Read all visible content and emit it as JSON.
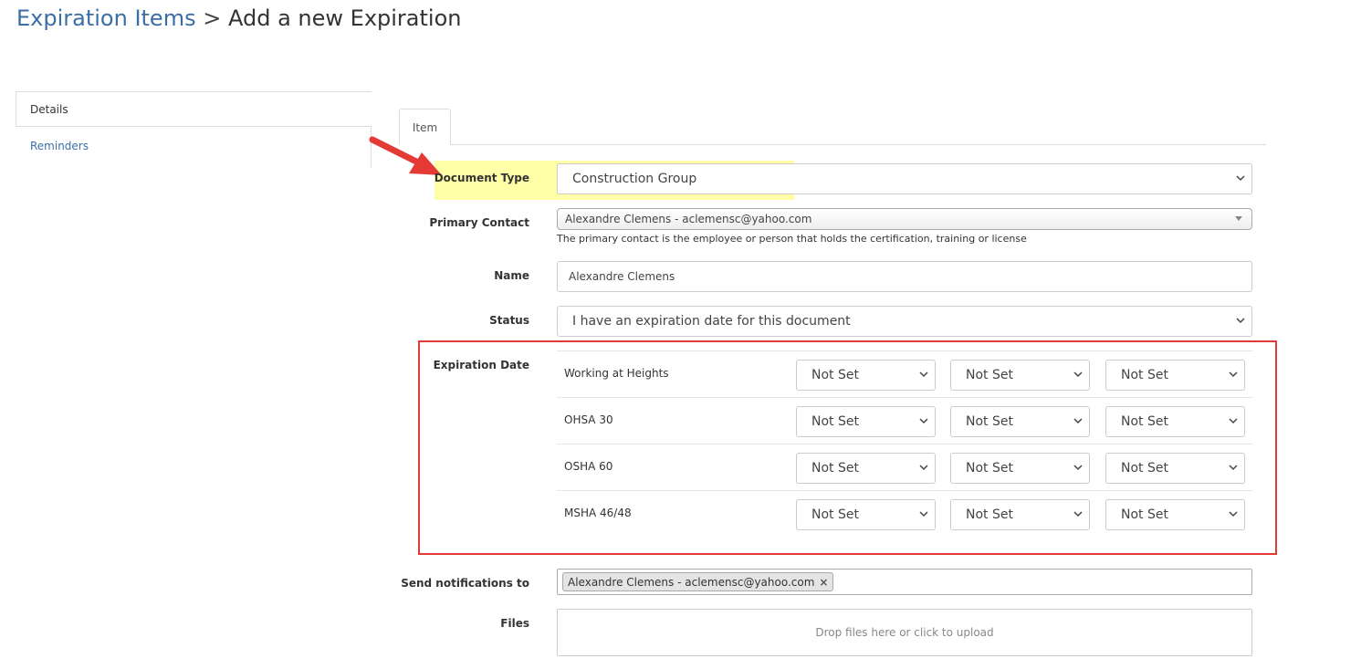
{
  "breadcrumb": {
    "parent": "Expiration Items",
    "separator": ">",
    "current": "Add a new Expiration"
  },
  "side_nav": {
    "items": [
      {
        "label": "Details",
        "active": true
      },
      {
        "label": "Reminders",
        "active": false
      }
    ]
  },
  "tabs": [
    {
      "label": "Item",
      "active": true
    }
  ],
  "form": {
    "document_type": {
      "label": "Document Type",
      "value": "Construction Group"
    },
    "primary_contact": {
      "label": "Primary Contact",
      "value": "Alexandre Clemens - aclemensc@yahoo.com",
      "help": "The primary contact is the employee or person that holds the certification, training or license"
    },
    "name": {
      "label": "Name",
      "value": "Alexandre Clemens"
    },
    "status": {
      "label": "Status",
      "value": "I have an expiration date for this document"
    },
    "expiration": {
      "label": "Expiration Date",
      "rows": [
        {
          "name": "Working at Heights",
          "selects": [
            "Not Set",
            "Not Set",
            "Not Set"
          ]
        },
        {
          "name": "OHSA 30",
          "selects": [
            "Not Set",
            "Not Set",
            "Not Set"
          ]
        },
        {
          "name": "OSHA 60",
          "selects": [
            "Not Set",
            "Not Set",
            "Not Set"
          ]
        },
        {
          "name": "MSHA 46/48",
          "selects": [
            "Not Set",
            "Not Set",
            "Not Set"
          ]
        }
      ]
    },
    "notifications": {
      "label": "Send notifications to",
      "tags": [
        "Alexandre Clemens - aclemensc@yahoo.com"
      ],
      "remove_glyph": "×"
    },
    "files": {
      "label": "Files",
      "placeholder": "Drop files here or click to upload"
    }
  },
  "annotations": {
    "highlight_color": "#ffff6e",
    "box_color": "#e53935",
    "arrow_color": "#e53935"
  },
  "colors": {
    "link": "#3b6ea8",
    "border": "#cccccc"
  }
}
